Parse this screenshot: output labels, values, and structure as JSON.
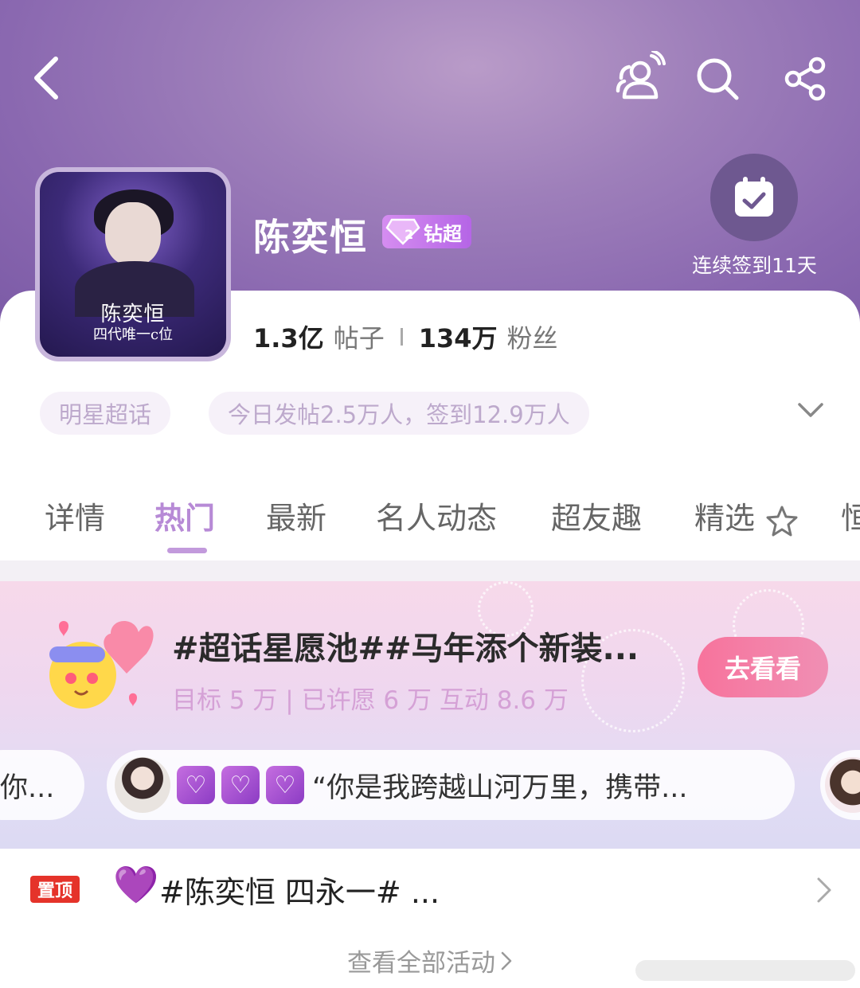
{
  "header": {
    "title": "陈奕恒",
    "badge_label": "钻超",
    "badge_level": "2",
    "checkin_text": "连续签到11天",
    "avatar_text_1": "陈奕恒",
    "avatar_text_2": "四代唯一c位"
  },
  "icons": {
    "back": "chevron-left-icon",
    "group": "group-icon",
    "search": "search-icon",
    "share": "share-icon",
    "checkin": "calendar-check-icon"
  },
  "stats": {
    "posts_value": "1.3亿",
    "posts_label": "帖子",
    "fans_value": "134万",
    "fans_label": "粉丝"
  },
  "chips": {
    "category": "明星超话",
    "today": "今日发帖2.5万人，签到12.9万人"
  },
  "tabs": [
    {
      "label": "详情"
    },
    {
      "label": "热门"
    },
    {
      "label": "最新"
    },
    {
      "label": "名人动态"
    },
    {
      "label": "超友趣"
    },
    {
      "label": "精选"
    },
    {
      "label": "恒"
    }
  ],
  "active_tab": "热门",
  "banner": {
    "title": "#超话星愿池##马年添个新装...",
    "subtitle": "目标 5 万 | 已许愿 6 万  互动 8.6 万",
    "button": "去看看",
    "pill_left_text": "你...",
    "pill_mid_text": "“你是我跨越山河万里，携带...",
    "heart_glyph": "♡"
  },
  "pinned": {
    "tag": "置顶",
    "text": "#陈奕恒 四永一#  ...",
    "heart": "💜"
  },
  "see_all": "查看全部活动",
  "colors": {
    "accent": "#b78ad6",
    "header_bg": "#9e7fba",
    "button_pink": "#f7739c",
    "pin_red": "#e5332a"
  }
}
